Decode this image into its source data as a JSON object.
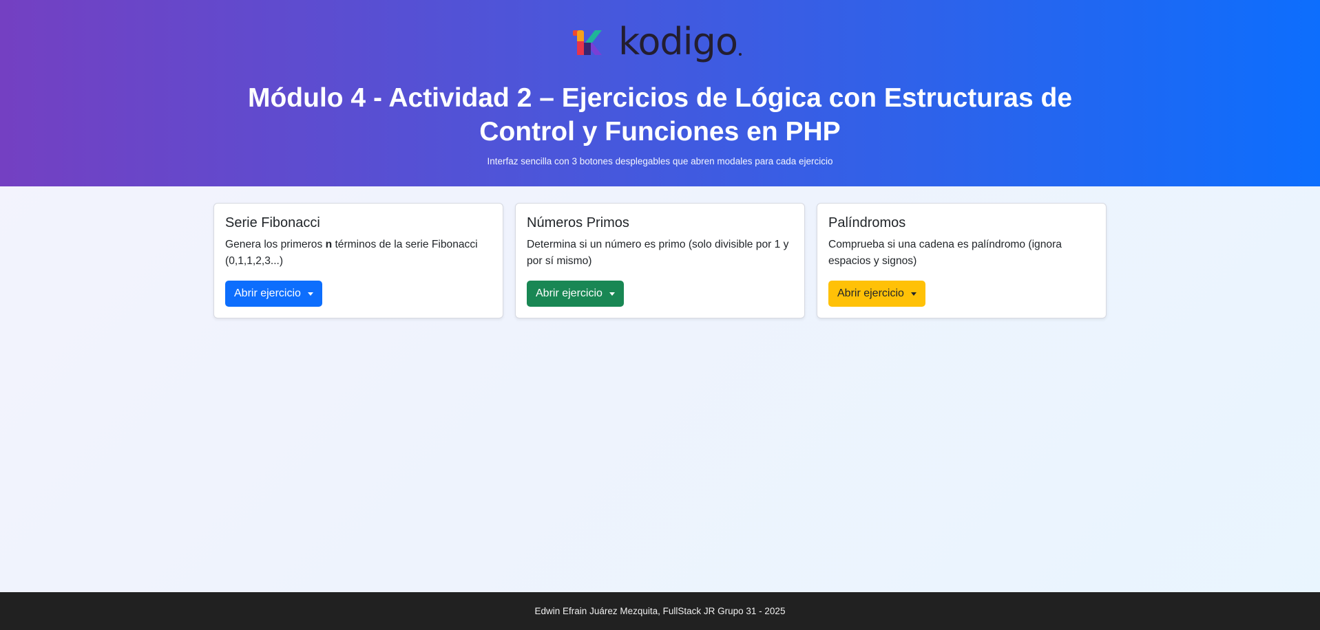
{
  "header": {
    "logo_text": "kodigo",
    "title": "Módulo 4 - Actividad 2 – Ejercicios de Lógica con Estructuras de Control y Funciones en PHP",
    "subtitle": "Interfaz sencilla con 3 botones desplegables que abren modales para cada ejercicio"
  },
  "cards": [
    {
      "title": "Serie Fibonacci",
      "desc_before": "Genera los primeros ",
      "desc_bold": "n",
      "desc_after": " términos de la serie Fibonacci (0,1,1,2,3...)",
      "button_label": "Abrir ejercicio",
      "button_color": "#0d6efd"
    },
    {
      "title": "Números Primos",
      "desc": "Determina si un número es primo (solo divisible por 1 y por sí mismo)",
      "button_label": "Abrir ejercicio",
      "button_color": "#198754"
    },
    {
      "title": "Palíndromos",
      "desc": "Comprueba si una cadena es palíndromo (ignora espacios y signos)",
      "button_label": "Abrir ejercicio",
      "button_color": "#ffc107"
    }
  ],
  "footer": {
    "text": "Edwin Efrain Juárez Mezquita, FullStack JR Grupo 31 - 2025"
  }
}
